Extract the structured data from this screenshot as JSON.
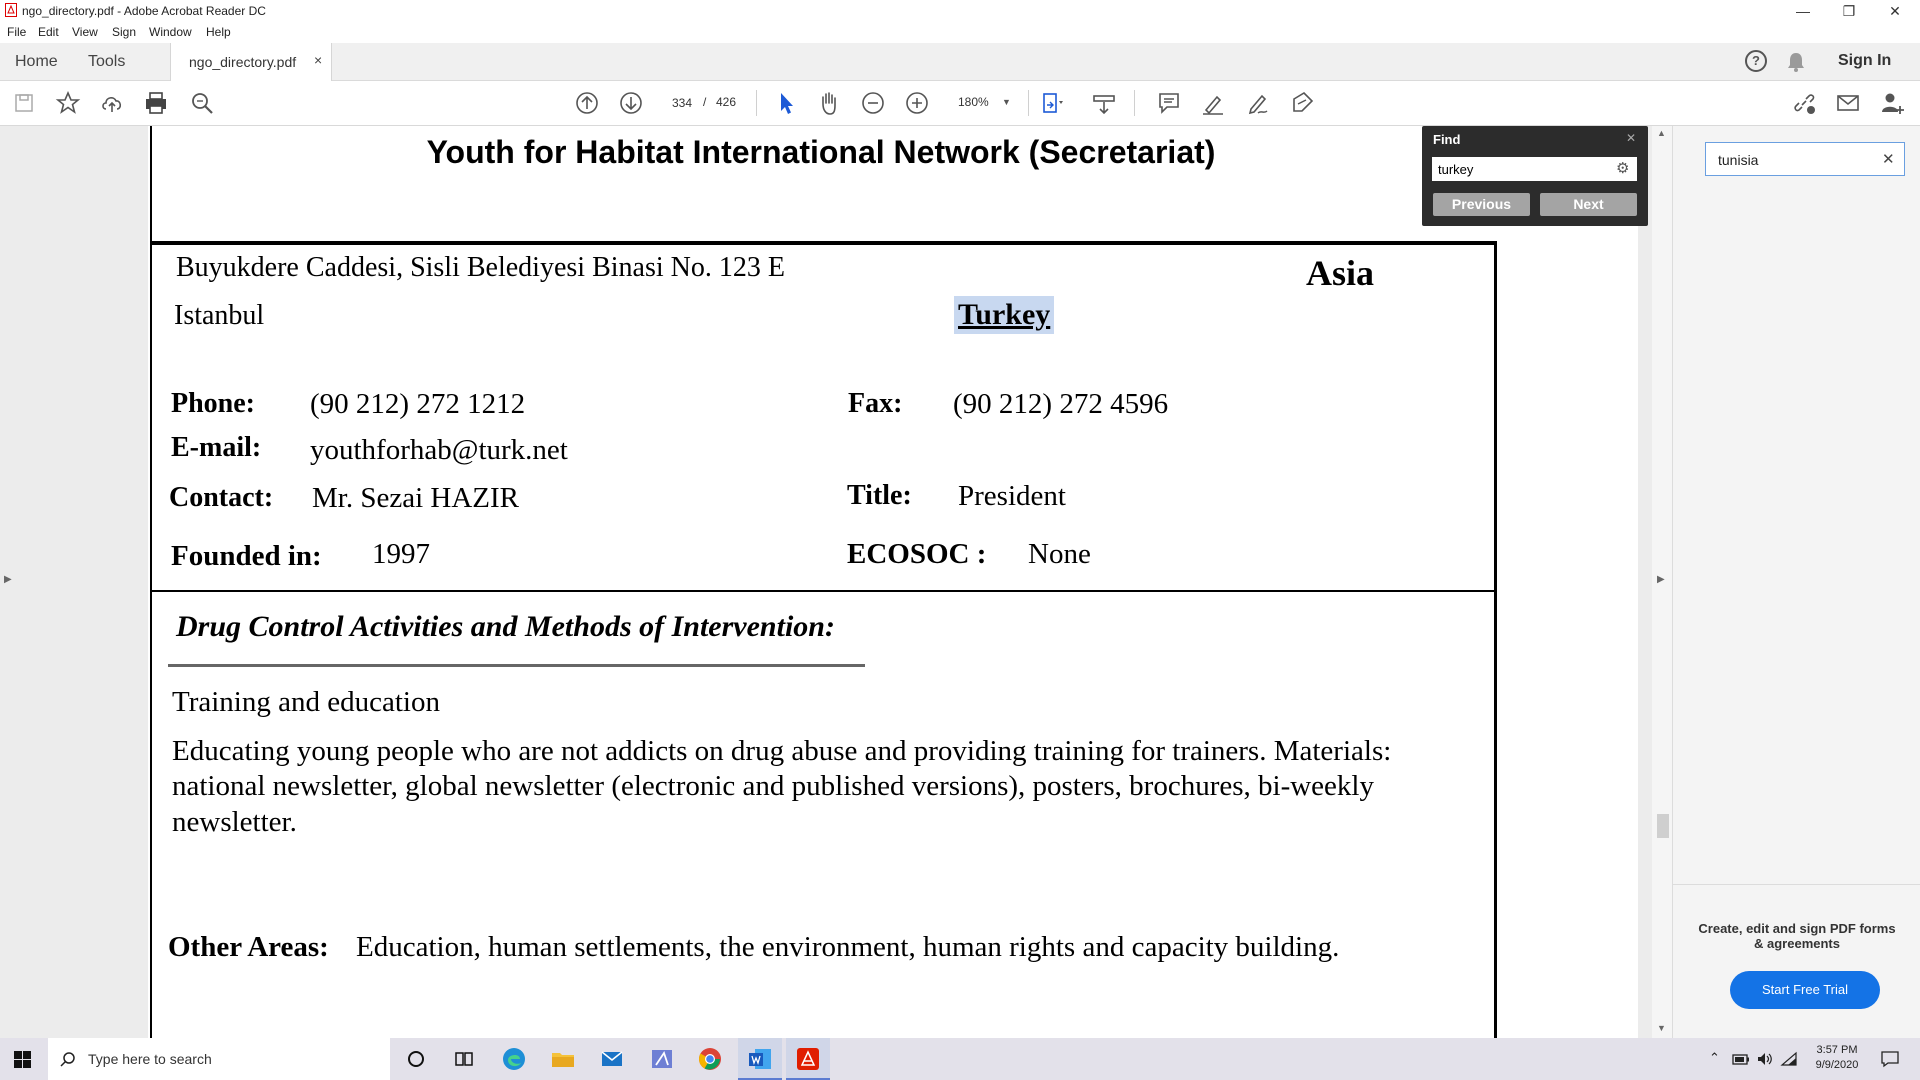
{
  "window": {
    "title": "ngo_directory.pdf - Adobe Acrobat Reader DC",
    "minimize": "—",
    "maximize": "❐",
    "close": "✕"
  },
  "menu": {
    "items": [
      "File",
      "Edit",
      "View",
      "Sign",
      "Window",
      "Help"
    ]
  },
  "tabs": {
    "home": "Home",
    "tools": "Tools",
    "document": "ngo_directory.pdf",
    "document_close": "×",
    "help_icon": "?",
    "sign_in": "Sign In"
  },
  "toolbar": {
    "current_page": "334",
    "page_separator": "/",
    "total_pages": "426",
    "zoom": "180%"
  },
  "find": {
    "title": "Find",
    "close": "✕",
    "query": "turkey",
    "previous": "Previous",
    "next": "Next"
  },
  "right_pane": {
    "search_value": "tunisia",
    "clear": "✕",
    "promo_text": "Create, edit and sign PDF forms & agreements",
    "trial_button": "Start Free Trial"
  },
  "document": {
    "org_name": "Youth for Habitat International Network (Secretariat)",
    "address": "Buyukdere Caddesi, Sisli Belediyesi Binasi No. 123 E",
    "city": "Istanbul",
    "region": "Asia",
    "country": "Turkey",
    "phone_label": "Phone:",
    "phone": "(90 212) 272 1212",
    "fax_label": "Fax:",
    "fax": "(90 212) 272 4596",
    "email_label": "E-mail:",
    "email": "youthforhab@turk.net",
    "contact_label": "Contact:",
    "contact": "Mr. Sezai HAZIR",
    "title_label": "Title:",
    "title_value": "President",
    "founded_label": "Founded in:",
    "founded": "1997",
    "ecosoc_label": "ECOSOC :",
    "ecosoc": "None",
    "section_heading": "Drug Control Activities and Methods of Intervention:",
    "activity": "Training and education",
    "description_line1": "Educating young people who are not addicts on drug abuse and providing training for trainers.  Materials:",
    "description_line2": "national newsletter, global newsletter (electronic and published versions), posters, brochures, bi-weekly",
    "description_line3": "newsletter.",
    "other_label": "Other Areas:",
    "other": "Education, human settlements, the environment, human rights and capacity building."
  },
  "taskbar": {
    "search_placeholder": "Type here to search",
    "time": "3:57 PM",
    "date": "9/9/2020"
  },
  "colors": {
    "find_bg": "#2c2c2c",
    "highlight": "#c8d8f0",
    "trial_button": "#1473e6",
    "acrobat_red": "#e01e00"
  }
}
